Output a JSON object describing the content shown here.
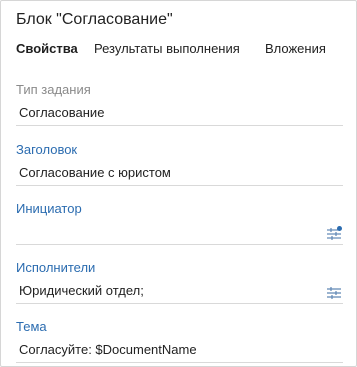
{
  "window": {
    "title": "Блок \"Согласование\""
  },
  "tabs": [
    {
      "label": "Свойства",
      "active": true
    },
    {
      "label": "Результаты выполнения",
      "active": false
    },
    {
      "label": "Вложения",
      "active": false
    }
  ],
  "fields": {
    "task_type": {
      "label": "Тип задания",
      "value": "Согласование"
    },
    "heading": {
      "label": "Заголовок",
      "value": "Согласование с юристом"
    },
    "initiator": {
      "label": "Инициатор",
      "value": ""
    },
    "performers": {
      "label": "Исполнители",
      "value": "Юридический отдел;"
    },
    "subject": {
      "label": "Тема",
      "value": "Согласуйте: $DocumentName"
    }
  },
  "icons": {
    "initiator_picker": "user-selector-icon",
    "performers_picker": "user-selector-icon"
  },
  "colors": {
    "accent": "#2b6cb0",
    "label_grey": "#8a8a8a",
    "picker_icon": "#5f87b5",
    "picker_dot": "#2b6cb0"
  }
}
